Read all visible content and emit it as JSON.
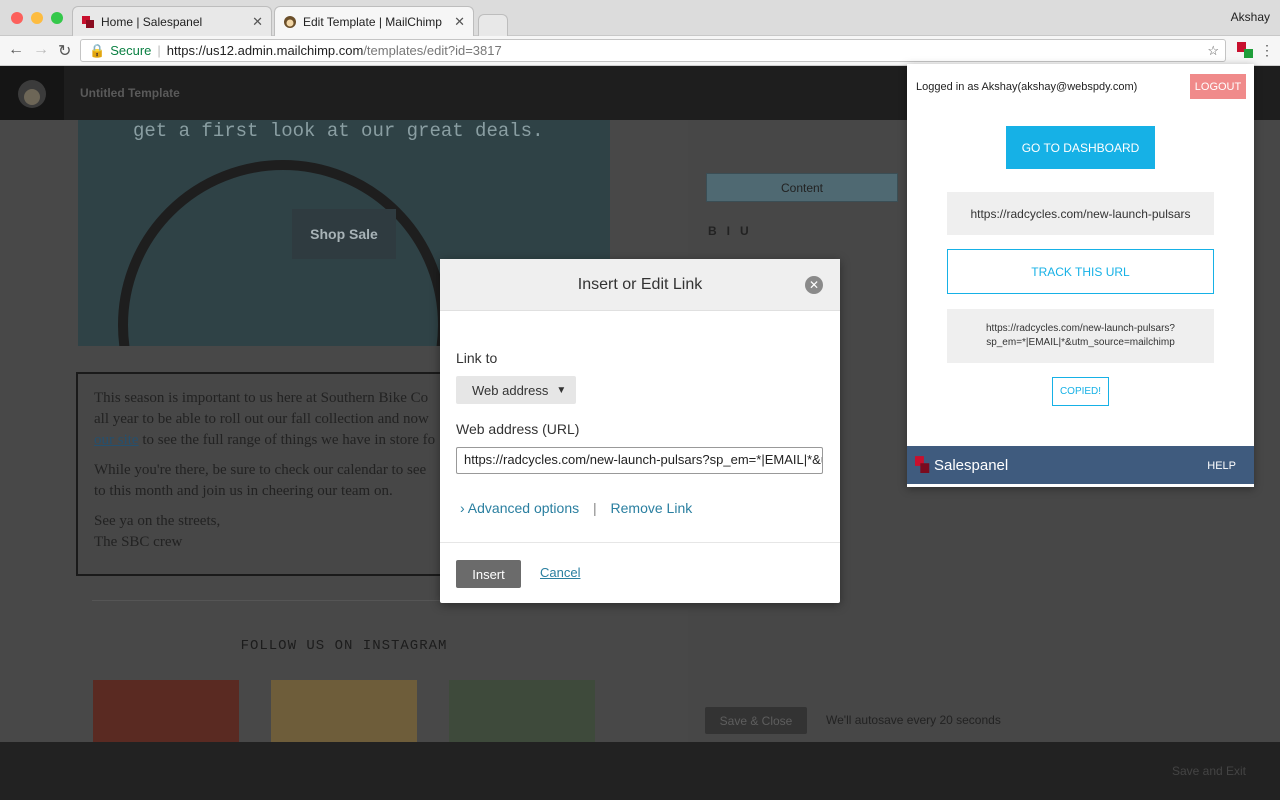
{
  "browser": {
    "user": "Akshay",
    "tabs": [
      {
        "title": "Home | Salespanel"
      },
      {
        "title": "Edit Template | MailChimp"
      }
    ],
    "secure_label": "Secure",
    "url_scheme_host": "https://us12.admin.mailchimp.com",
    "url_path": "/templates/edit?id=3817"
  },
  "app": {
    "template_title": "Untitled Template",
    "hero_tagline": "get a first look at our great deals.",
    "shop_button": "Shop Sale",
    "body_p1_a": "This season is important to us here at Southern Bike Co",
    "body_p1_b": "all year to be able to roll out our fall collection and now",
    "body_p1_link": "our site",
    "body_p1_c": " to see the full range of things we have in store fo",
    "body_p2_a": "While you're there, be sure to check our calendar to see",
    "body_p2_b": "to this month and join us in cheering our team on.",
    "body_p3_a": "See ya on the streets,",
    "body_p3_b": "The SBC crew",
    "follow_heading": "FOLLOW US ON INSTAGRAM",
    "content_tab": "Content",
    "save_close": "Save & Close",
    "autosave_note": "We'll autosave every 20 seconds",
    "save_exit": "Save and Exit"
  },
  "modal": {
    "title": "Insert or Edit Link",
    "link_to_label": "Link to",
    "link_type": "Web address",
    "url_label": "Web address (URL)",
    "url_value": "https://radcycles.com/new-launch-pulsars?sp_em=*|EMAIL|*&utm_source=mailchimp",
    "advanced": "Advanced options",
    "remove": "Remove Link",
    "insert": "Insert",
    "cancel": "Cancel"
  },
  "salespanel": {
    "logged_in": "Logged in as Akshay(akshay@webspdy.com)",
    "logout": "LOGOUT",
    "dashboard": "GO TO DASHBOARD",
    "source_url": "https://radcycles.com/new-launch-pulsars",
    "track": "TRACK THIS URL",
    "tracked_line1": "https://radcycles.com/new-launch-pulsars?",
    "tracked_line2": "sp_em=*|EMAIL|*&utm_source=mailchimp",
    "copied": "COPIED!",
    "brand": "Salespanel",
    "help": "HELP"
  },
  "colors": {
    "accent": "#16b1e6",
    "logout": "#f08a8a",
    "footer": "#3f5b7e"
  }
}
